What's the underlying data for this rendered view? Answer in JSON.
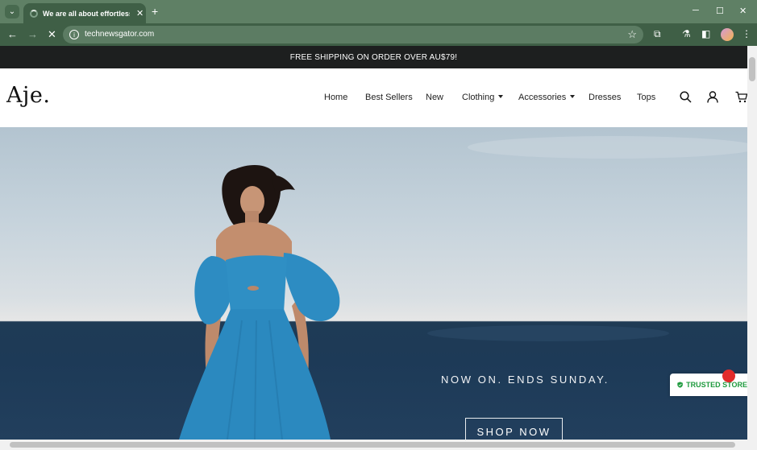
{
  "browser": {
    "tab_title": "We are all about effortless style",
    "url": "technewsgator.com",
    "new_tab_glyph": "+",
    "close_glyph": "✕"
  },
  "promo": {
    "text": "FREE SHIPPING ON ORDER OVER AU$79!"
  },
  "header": {
    "logo": "Aje.",
    "nav": [
      {
        "label": "Home"
      },
      {
        "label": "Best Sellers"
      },
      {
        "label": "New"
      },
      {
        "label": "Clothing",
        "dropdown": true
      },
      {
        "label": "Accessories",
        "dropdown": true
      },
      {
        "label": "Dresses"
      },
      {
        "label": "Tops"
      }
    ]
  },
  "hero": {
    "headline": "NOW ON. ENDS SUNDAY.",
    "cta": "SHOP NOW"
  },
  "trusted": {
    "label": "TRUSTED STORE"
  },
  "colors": {
    "promo_bg": "#1d1f1f",
    "dress": "#2f8fc4",
    "trusted_green": "#1e9a3e",
    "browser_frame": "#3f5f46"
  }
}
